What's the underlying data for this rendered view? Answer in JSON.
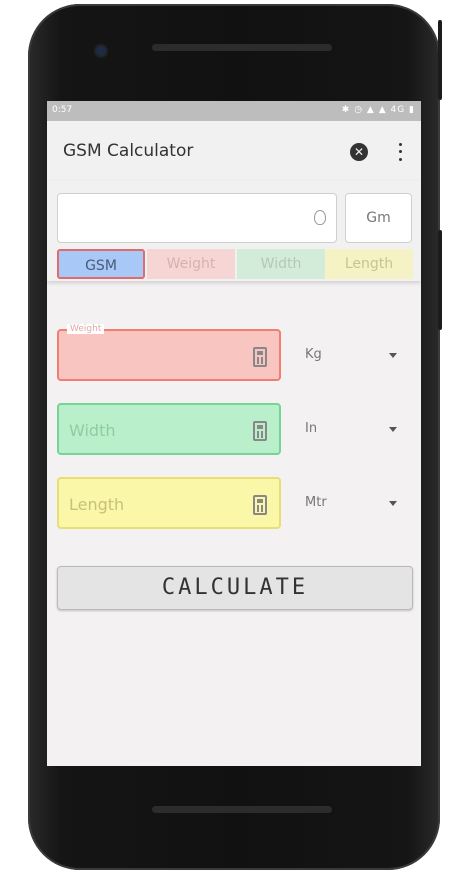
{
  "status_bar": {
    "time": "0:57",
    "icons": "✱ ◷ ▲ ▲ 4G ▮"
  },
  "app": {
    "title": "GSM Calculator"
  },
  "result": {
    "unit": "Gm"
  },
  "tabs": {
    "gsm": "GSM",
    "weight": "Weight",
    "width": "Width",
    "length": "Length"
  },
  "fields": {
    "weight": {
      "label": "Weight",
      "unit": "Kg"
    },
    "width": {
      "placeholder": "Width",
      "unit": "In"
    },
    "length": {
      "placeholder": "Length",
      "unit": "Mtr"
    }
  },
  "calculate_label": "CALCULATE",
  "colors": {
    "gsm_tab": "#a8c8f8",
    "weight": "#f9c5c0",
    "width": "#b9efcb",
    "length": "#fbf7a8"
  }
}
